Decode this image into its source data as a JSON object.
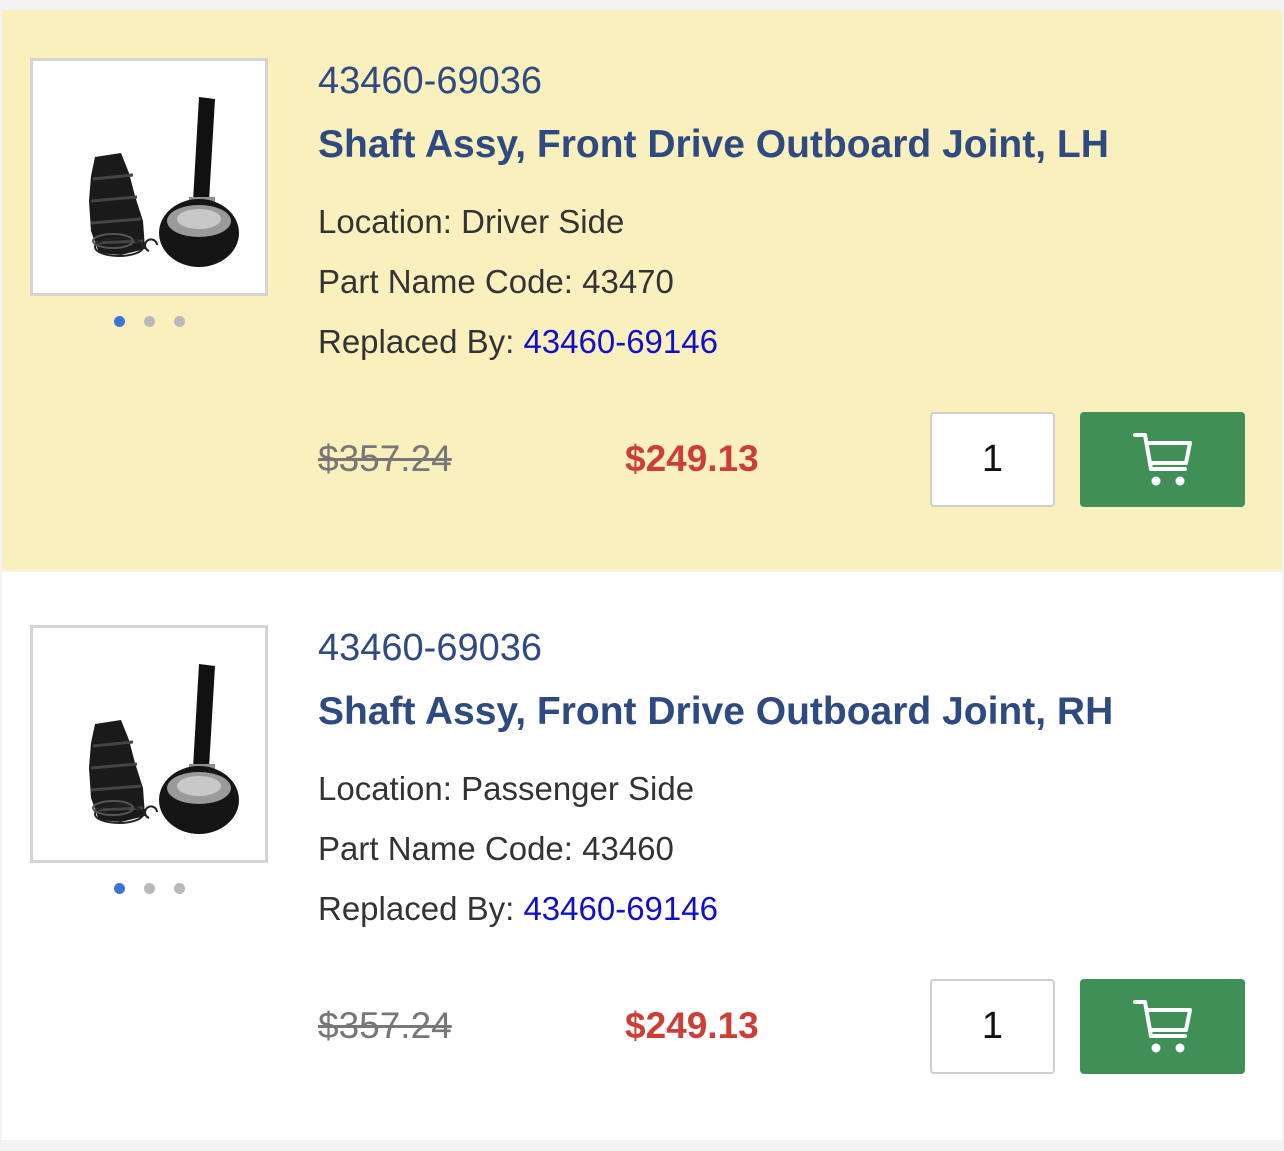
{
  "products": [
    {
      "part_number": "43460-69036",
      "title": "Shaft Assy, Front Drive Outboard Joint, LH",
      "location_label": "Location:",
      "location": "Driver Side",
      "code_label": "Part Name Code:",
      "code": "43470",
      "replaced_label": "Replaced By:",
      "replaced_by": "43460-69146",
      "original_price": "$357.24",
      "sale_price": "$249.13",
      "quantity": "1",
      "image_count": 3,
      "active_image": 1,
      "cart_icon": "cart-icon"
    },
    {
      "part_number": "43460-69036",
      "title": "Shaft Assy, Front Drive Outboard Joint, RH",
      "location_label": "Location:",
      "location": "Passenger Side",
      "code_label": "Part Name Code:",
      "code": "43460",
      "replaced_label": "Replaced By:",
      "replaced_by": "43460-69146",
      "original_price": "$357.24",
      "sale_price": "$249.13",
      "quantity": "1",
      "image_count": 3,
      "active_image": 1,
      "cart_icon": "cart-icon"
    }
  ],
  "colors": {
    "highlight_bg": "#f9f0bd",
    "title": "#2e4a80",
    "link": "#1010c8",
    "sale": "#cc3f36",
    "cart_button": "#3f8f57"
  }
}
